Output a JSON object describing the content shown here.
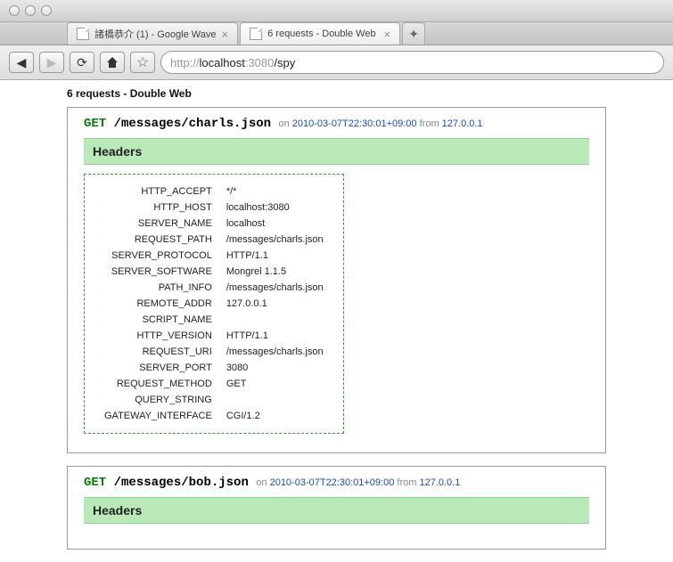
{
  "window": {
    "tabs": [
      {
        "title": "諸橋恭介 (1) - Google Wave",
        "active": false
      },
      {
        "title": "6 requests - Double Web",
        "active": true
      }
    ]
  },
  "toolbar": {
    "url": {
      "protocol": "http://",
      "host": "localhost",
      "port": ":3080",
      "path": "/spy"
    }
  },
  "page": {
    "heading": "6 requests - Double Web"
  },
  "requests": [
    {
      "method": "GET",
      "path": "/messages/charls.json",
      "on_label": "on",
      "timestamp": "2010-03-07T22:30:01+09:00",
      "from_label": "from",
      "ip": "127.0.0.1",
      "headers_title": "Headers",
      "headers": [
        {
          "key": "HTTP_ACCEPT",
          "value": "*/*"
        },
        {
          "key": "HTTP_HOST",
          "value": "localhost:3080"
        },
        {
          "key": "SERVER_NAME",
          "value": "localhost"
        },
        {
          "key": "REQUEST_PATH",
          "value": "/messages/charls.json"
        },
        {
          "key": "SERVER_PROTOCOL",
          "value": "HTTP/1.1"
        },
        {
          "key": "SERVER_SOFTWARE",
          "value": "Mongrel 1.1.5"
        },
        {
          "key": "PATH_INFO",
          "value": "/messages/charls.json"
        },
        {
          "key": "REMOTE_ADDR",
          "value": "127.0.0.1"
        },
        {
          "key": "SCRIPT_NAME",
          "value": ""
        },
        {
          "key": "HTTP_VERSION",
          "value": "HTTP/1.1"
        },
        {
          "key": "REQUEST_URI",
          "value": "/messages/charls.json"
        },
        {
          "key": "SERVER_PORT",
          "value": "3080"
        },
        {
          "key": "REQUEST_METHOD",
          "value": "GET"
        },
        {
          "key": "QUERY_STRING",
          "value": ""
        },
        {
          "key": "GATEWAY_INTERFACE",
          "value": "CGI/1.2"
        }
      ]
    },
    {
      "method": "GET",
      "path": "/messages/bob.json",
      "on_label": "on",
      "timestamp": "2010-03-07T22:30:01+09:00",
      "from_label": "from",
      "ip": "127.0.0.1",
      "headers_title": "Headers"
    }
  ]
}
